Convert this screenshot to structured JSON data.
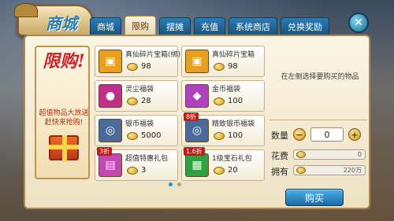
{
  "title": "商城",
  "tabs": [
    "商城",
    "限购",
    "摆摊",
    "充值",
    "系统商店",
    "兑换奖励"
  ],
  "active_tab": 1,
  "promo": {
    "headline": "限购!",
    "subtitle_line1": "超值物品大放送",
    "subtitle_line2": "赶快来抢购!"
  },
  "items": [
    {
      "name": "真仙碎片宝箱(绑)",
      "price": "98",
      "discount": "",
      "icon": "treasure-chest-icon",
      "color": "#e8a020"
    },
    {
      "name": "真仙碎片宝箱",
      "price": "98",
      "discount": "",
      "icon": "treasure-chest-icon",
      "color": "#e8a020"
    },
    {
      "name": "灵尘福袋",
      "price": "28",
      "discount": "",
      "icon": "pouch-icon",
      "color": "#c0308a"
    },
    {
      "name": "金币福袋",
      "price": "100",
      "discount": "",
      "icon": "coin-pouch-icon",
      "color": "#b040c0"
    },
    {
      "name": "银币福袋",
      "price": "5000",
      "discount": "",
      "icon": "silver-coin-icon",
      "color": "#4a6a9a"
    },
    {
      "name": "精致银币福袋",
      "price": "100",
      "discount": "8折",
      "icon": "silver-coin-icon",
      "color": "#4a6a9a"
    },
    {
      "name": "超值特惠礼包",
      "price": "3",
      "discount": "3折",
      "icon": "gift-box-icon",
      "color": "#c04ab0"
    },
    {
      "name": "1级宝石礼包",
      "price": "20",
      "discount": "1.6折",
      "icon": "gem-box-icon",
      "color": "#30a040"
    }
  ],
  "hint": "在左侧选择要购买的物品",
  "quantity_label": "数量",
  "quantity": "0",
  "cost_label": "花费",
  "cost_value": "0",
  "own_label": "拥有",
  "own_value": "220万",
  "buy_label": "购买",
  "page_dots": 2,
  "active_dot": 0,
  "close_symbol": "✕"
}
